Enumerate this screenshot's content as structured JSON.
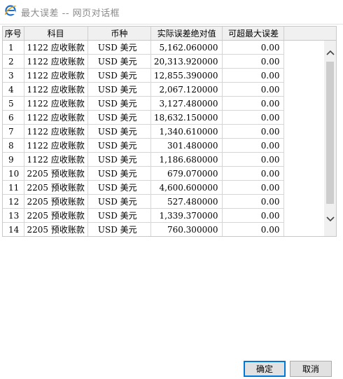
{
  "window": {
    "title": "最大误差 -- 网页对话框",
    "icon": "ie-icon"
  },
  "table": {
    "headers": [
      "序号",
      "科目",
      "币种",
      "实际误差绝对值",
      "可超最大误差"
    ],
    "rows": [
      {
        "no": "1",
        "subject": "1122 应收账款",
        "currency": "USD 美元",
        "actual": "5,162.060000",
        "max": "0.00"
      },
      {
        "no": "2",
        "subject": "1122 应收账款",
        "currency": "USD 美元",
        "actual": "20,313.920000",
        "max": "0.00"
      },
      {
        "no": "3",
        "subject": "1122 应收账款",
        "currency": "USD 美元",
        "actual": "12,855.390000",
        "max": "0.00"
      },
      {
        "no": "4",
        "subject": "1122 应收账款",
        "currency": "USD 美元",
        "actual": "2,067.120000",
        "max": "0.00"
      },
      {
        "no": "5",
        "subject": "1122 应收账款",
        "currency": "USD 美元",
        "actual": "3,127.480000",
        "max": "0.00"
      },
      {
        "no": "6",
        "subject": "1122 应收账款",
        "currency": "USD 美元",
        "actual": "18,632.150000",
        "max": "0.00"
      },
      {
        "no": "7",
        "subject": "1122 应收账款",
        "currency": "USD 美元",
        "actual": "1,340.610000",
        "max": "0.00"
      },
      {
        "no": "8",
        "subject": "1122 应收账款",
        "currency": "USD 美元",
        "actual": "301.480000",
        "max": "0.00"
      },
      {
        "no": "9",
        "subject": "1122 应收账款",
        "currency": "USD 美元",
        "actual": "1,186.680000",
        "max": "0.00"
      },
      {
        "no": "10",
        "subject": "2205 预收账款",
        "currency": "USD 美元",
        "actual": "679.070000",
        "max": "0.00"
      },
      {
        "no": "11",
        "subject": "2205 预收账款",
        "currency": "USD 美元",
        "actual": "4,600.600000",
        "max": "0.00"
      },
      {
        "no": "12",
        "subject": "2205 预收账款",
        "currency": "USD 美元",
        "actual": "527.480000",
        "max": "0.00"
      },
      {
        "no": "13",
        "subject": "2205 预收账款",
        "currency": "USD 美元",
        "actual": "1,339.370000",
        "max": "0.00"
      },
      {
        "no": "14",
        "subject": "2205 预收账款",
        "currency": "USD 美元",
        "actual": "760.300000",
        "max": "0.00"
      }
    ]
  },
  "buttons": {
    "ok_label": "确定",
    "cancel_label": "取消"
  }
}
